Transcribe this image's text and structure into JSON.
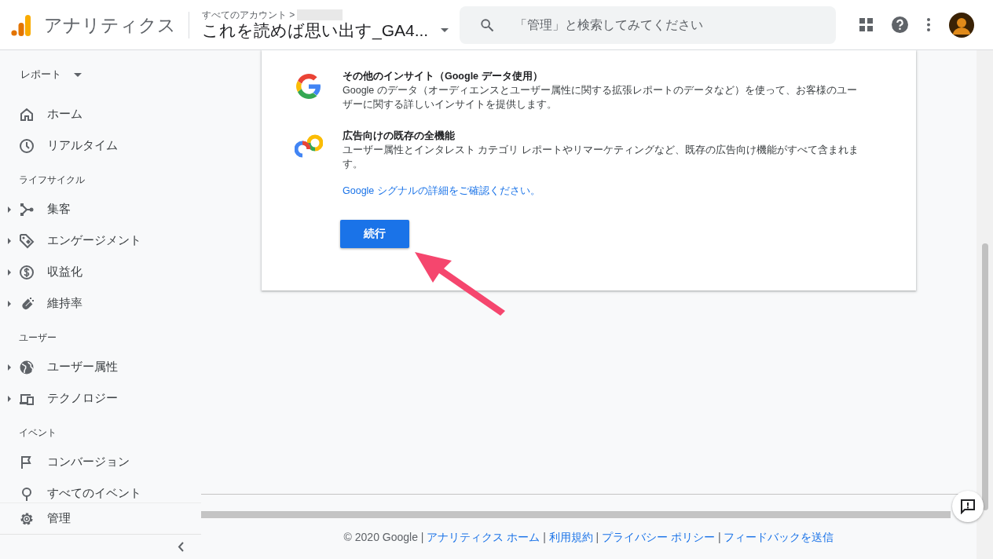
{
  "header": {
    "app_name": "アナリティクス",
    "breadcrumb": "すべてのアカウント >",
    "property": "これを読めば思い出す_GA4...",
    "search": {
      "placeholder": "「管理」と検索してみてください"
    }
  },
  "sidebar": {
    "report_menu": "レポート",
    "sections": [
      {
        "items": [
          {
            "label": "ホーム",
            "kind": "home",
            "expandable": false
          },
          {
            "label": "リアルタイム",
            "kind": "clock",
            "expandable": false
          }
        ]
      },
      {
        "heading": "ライフサイクル",
        "items": [
          {
            "label": "集客",
            "kind": "branch",
            "expandable": true
          },
          {
            "label": "エンゲージメント",
            "kind": "tag",
            "expandable": true
          },
          {
            "label": "収益化",
            "kind": "dollar",
            "expandable": true
          },
          {
            "label": "維持率",
            "kind": "magnet",
            "expandable": true
          }
        ]
      },
      {
        "heading": "ユーザー",
        "items": [
          {
            "label": "ユーザー属性",
            "kind": "globe",
            "expandable": true
          },
          {
            "label": "テクノロジー",
            "kind": "devices",
            "expandable": true
          }
        ]
      },
      {
        "heading": "イベント",
        "items": [
          {
            "label": "コンバージョン",
            "kind": "flag",
            "expandable": false
          },
          {
            "label": "すべてのイベント",
            "kind": "pin",
            "expandable": false
          }
        ]
      }
    ],
    "admin": "管理"
  },
  "card": {
    "features": [
      {
        "kind": "google",
        "title": "その他のインサイト（Google データ使用）",
        "description": "Google のデータ（オーディエンスとユーザー属性に関する拡張レポートのデータなど）を使って、お客様のユーザーに関する詳しいインサイトを提供します。"
      },
      {
        "kind": "rings",
        "title": "広告向けの既存の全機能",
        "description": "ユーザー属性とインタレスト カテゴリ レポートやリマーケティングなど、既存の広告向け機能がすべて含まれます。"
      }
    ],
    "link": "Google シグナルの詳細をご確認ください。",
    "button": "続行"
  },
  "footer": [
    {
      "kind": "text",
      "text": "© 2020 Google"
    },
    {
      "kind": "separator",
      "text": "|"
    },
    {
      "kind": "link",
      "text": "アナリティクス ホーム"
    },
    {
      "kind": "separator",
      "text": "|"
    },
    {
      "kind": "link",
      "text": "利用規約"
    },
    {
      "kind": "separator",
      "text": "|"
    },
    {
      "kind": "link",
      "text": "プライバシー ポリシー"
    },
    {
      "kind": "separator",
      "text": "|"
    },
    {
      "kind": "link",
      "text": "フィードバックを送信"
    }
  ]
}
